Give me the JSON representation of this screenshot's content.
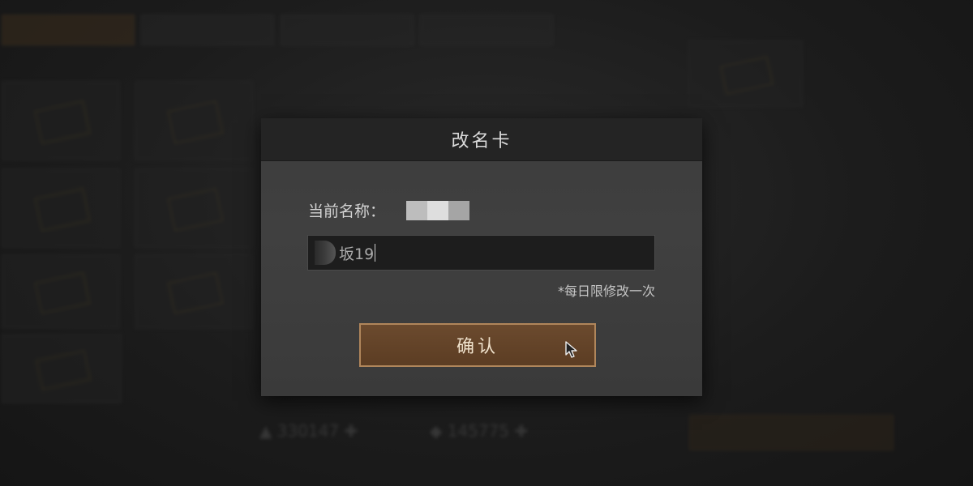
{
  "dialog": {
    "title": "改名卡",
    "current_name_label": "当前名称：",
    "input_value": "坂19",
    "input_hint": "*每日限修改一次",
    "confirm_label": "确认"
  },
  "background": {
    "bottom_stat_1": "330147",
    "bottom_stat_2": "145775"
  },
  "colors": {
    "accent": "#6b4a2e",
    "accent_border": "#b0865b",
    "dialog_bg": "#3c3c3c",
    "header_bg": "#242424"
  },
  "icons": {
    "cursor": "mouse-pointer-icon"
  }
}
